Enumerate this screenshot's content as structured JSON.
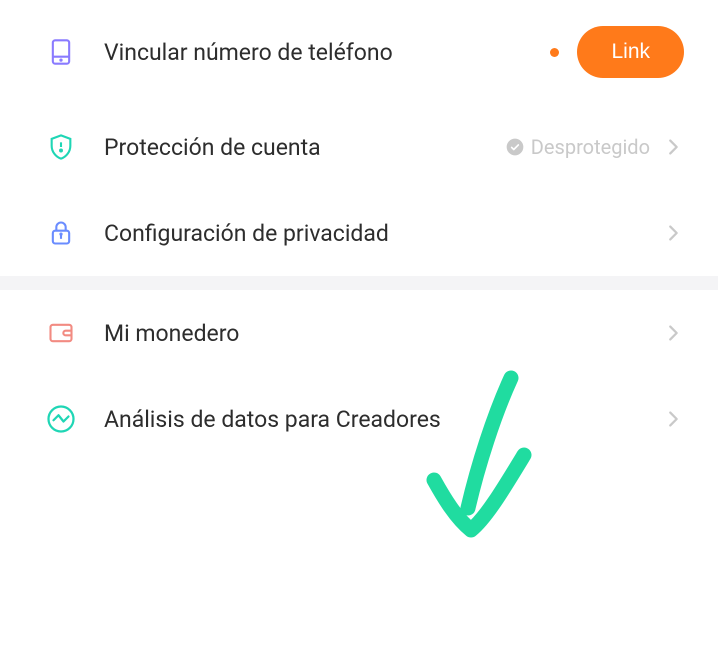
{
  "rows": {
    "link_phone": {
      "label": "Vincular número de teléfono",
      "button_label": "Link"
    },
    "account_protection": {
      "label": "Protección de cuenta",
      "status": "Desprotegido"
    },
    "privacy": {
      "label": "Configuración de privacidad"
    },
    "wallet": {
      "label": "Mi monedero"
    },
    "creator_analytics": {
      "label": "Análisis de datos para Creadores"
    }
  }
}
